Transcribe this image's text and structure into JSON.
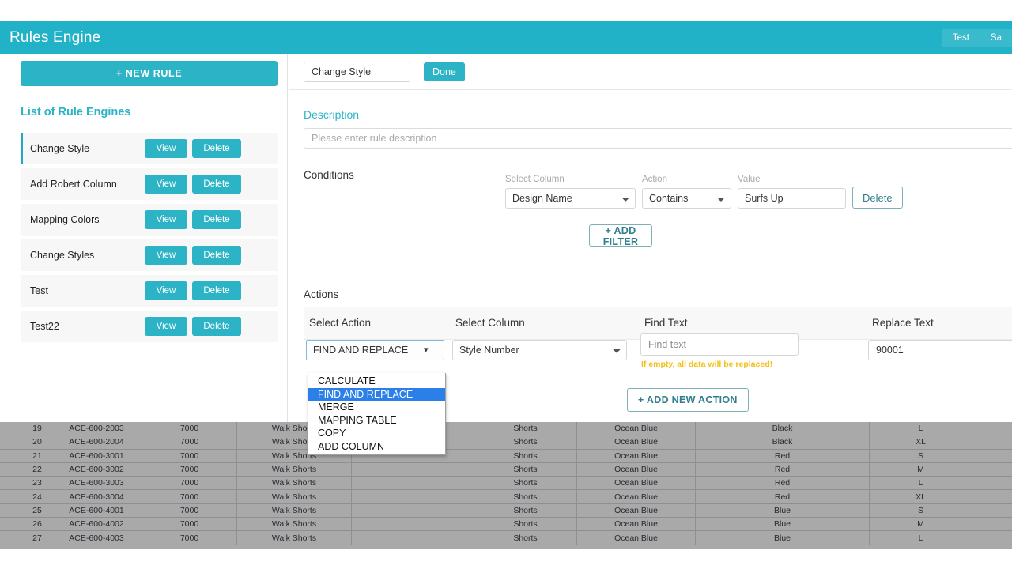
{
  "header": {
    "title": "Rules Engine",
    "buttons": [
      {
        "label": "Test",
        "name": "test-button"
      },
      {
        "label": "Sa",
        "name": "save-button"
      }
    ]
  },
  "sidebar": {
    "new_rule_label": "+ NEW RULE",
    "list_heading": "List of Rule Engines",
    "view_label": "View",
    "delete_label": "Delete",
    "items": [
      {
        "name": "Change Style",
        "active": true
      },
      {
        "name": "Add Robert Column",
        "active": false
      },
      {
        "name": "Mapping Colors",
        "active": false
      },
      {
        "name": "Change Styles",
        "active": false
      },
      {
        "name": "Test",
        "active": false
      },
      {
        "name": "Test22",
        "active": false
      }
    ]
  },
  "rule_editor": {
    "rule_name_value": "Change Style",
    "done_label": "Done",
    "description": {
      "label": "Description",
      "value": "",
      "placeholder": "Please enter rule description"
    },
    "conditions": {
      "title": "Conditions",
      "labels": {
        "select_column": "Select Column",
        "action": "Action",
        "value": "Value"
      },
      "row": {
        "column_value": "Design Name",
        "action_value": "Contains",
        "value": "Surfs Up",
        "delete_label": "Delete"
      },
      "add_filter_label": "+ ADD FILTER"
    },
    "actions": {
      "title": "Actions",
      "columns": [
        "Select Action",
        "Select Column",
        "Find Text",
        "Replace Text"
      ],
      "row": {
        "action_value": "FIND AND REPLACE",
        "column_value": "Style Number",
        "find_text_value": "",
        "find_text_placeholder": "Find text",
        "find_text_note": "If empty, all data will be replaced!",
        "replace_text_value": "90001"
      },
      "add_action_label": "+ ADD NEW ACTION",
      "action_options": [
        {
          "label": "CALCULATE",
          "selected": false
        },
        {
          "label": "FIND AND REPLACE",
          "selected": true
        },
        {
          "label": "MERGE",
          "selected": false
        },
        {
          "label": "MAPPING TABLE",
          "selected": false
        },
        {
          "label": "COPY",
          "selected": false
        },
        {
          "label": "ADD COLUMN",
          "selected": false
        }
      ]
    }
  },
  "data_table": {
    "rows": [
      [
        "19",
        "ACE-600-2003",
        "7000",
        "Walk Shorts",
        "",
        "Shorts",
        "Ocean Blue",
        "Black",
        "L",
        ""
      ],
      [
        "20",
        "ACE-600-2004",
        "7000",
        "Walk Shorts",
        "",
        "Shorts",
        "Ocean Blue",
        "Black",
        "XL",
        ""
      ],
      [
        "21",
        "ACE-600-3001",
        "7000",
        "Walk Shorts",
        "",
        "Shorts",
        "Ocean Blue",
        "Red",
        "S",
        ""
      ],
      [
        "22",
        "ACE-600-3002",
        "7000",
        "Walk Shorts",
        "",
        "Shorts",
        "Ocean Blue",
        "Red",
        "M",
        ""
      ],
      [
        "23",
        "ACE-600-3003",
        "7000",
        "Walk Shorts",
        "",
        "Shorts",
        "Ocean Blue",
        "Red",
        "L",
        ""
      ],
      [
        "24",
        "ACE-600-3004",
        "7000",
        "Walk Shorts",
        "",
        "Shorts",
        "Ocean Blue",
        "Red",
        "XL",
        ""
      ],
      [
        "25",
        "ACE-600-4001",
        "7000",
        "Walk Shorts",
        "",
        "Shorts",
        "Ocean Blue",
        "Blue",
        "S",
        ""
      ],
      [
        "26",
        "ACE-600-4002",
        "7000",
        "Walk Shorts",
        "",
        "Shorts",
        "Ocean Blue",
        "Blue",
        "M",
        ""
      ],
      [
        "27",
        "ACE-600-4003",
        "7000",
        "Walk Shorts",
        "",
        "Shorts",
        "Ocean Blue",
        "Blue",
        "L",
        ""
      ]
    ]
  },
  "colors": {
    "brand_teal": "#22b2c7",
    "accent_teal": "#2cb4c6",
    "warning_yellow": "#f3c016",
    "dropdown_selected": "#2a7fe8",
    "table_bg": "#a9a9a9"
  }
}
